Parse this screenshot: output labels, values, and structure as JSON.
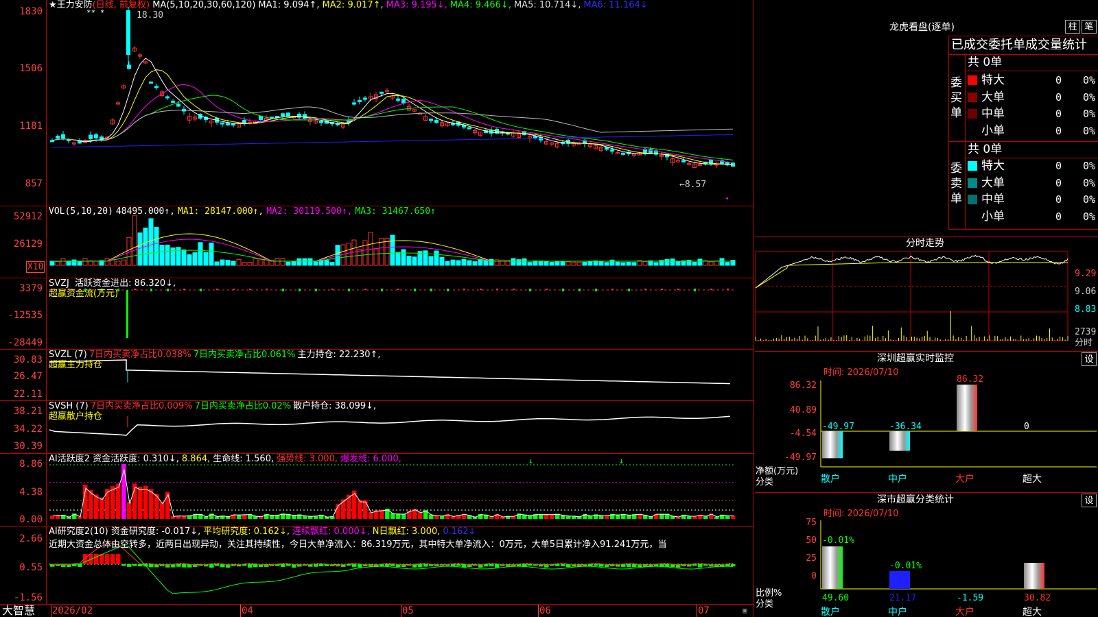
{
  "stock": {
    "name": "王力安防",
    "period": "(日线, 前复权)"
  },
  "main": {
    "y_ticks": [
      "1830",
      "1506",
      "1181",
      "857"
    ],
    "high_label": "18.30",
    "low_label": "8.57",
    "ma_parts": [
      {
        "text": "MA(5,10,20,30,60,120)",
        "color": "#ffffff"
      },
      {
        "text": "MA1: 9.094↑,",
        "color": "#ffffff"
      },
      {
        "text": "MA2: 9.017↑,",
        "color": "#ffff00"
      },
      {
        "text": "MA3: 9.195↓,",
        "color": "#ff00ff"
      },
      {
        "text": "MA4: 9.466↓,",
        "color": "#00ff00"
      },
      {
        "text": "MA5: 10.714↓,",
        "color": "#dddddd"
      },
      {
        "text": "MA6: 11.164↓",
        "color": "#3030ff"
      }
    ]
  },
  "vol": {
    "y_ticks": [
      "52912",
      "26129"
    ],
    "unit": "X10",
    "parts": [
      {
        "text": "VOL(5,10,20)",
        "color": "#ffffff"
      },
      {
        "text": "48495.000↑,",
        "color": "#ffffff"
      },
      {
        "text": "MA1: 28147.000↑,",
        "color": "#ffff00"
      },
      {
        "text": "MA2: 30119.500↑,",
        "color": "#ff00ff"
      },
      {
        "text": "MA3: 31467.650↑",
        "color": "#00ff00"
      }
    ]
  },
  "svzj": {
    "y_ticks": [
      "3379",
      "-12535",
      "-28449"
    ],
    "title": "SVZJ",
    "line1": "活跃资金进出: 86.320↓,",
    "line2": "超赢资金流(万元)"
  },
  "svzl": {
    "y_ticks": [
      "30.83",
      "26.47",
      "22.11"
    ],
    "parts": [
      {
        "text": "SVZL (7)",
        "color": "#ffffff"
      },
      {
        "text": "7日内买卖净占比0.038%",
        "color": "#ff3030"
      },
      {
        "text": "7日内买卖净占比0.061%",
        "color": "#00ff00"
      },
      {
        "text": "主力持仓: 22.230↑,",
        "color": "#ffffff"
      }
    ],
    "line2": "超赢主力持仓"
  },
  "svsh": {
    "y_ticks": [
      "38.21",
      "34.22",
      "30.39"
    ],
    "parts": [
      {
        "text": "SVSH (7)",
        "color": "#ffffff"
      },
      {
        "text": "7日内买卖净占比0.009%",
        "color": "#ff3030"
      },
      {
        "text": "7日内买卖净占比0.02%",
        "color": "#00ff00"
      },
      {
        "text": "散户持仓: 38.099↓,",
        "color": "#ffffff"
      }
    ],
    "line2": "超赢散户持仓"
  },
  "ai1": {
    "y_ticks": [
      "8.86",
      "4.38",
      "0.00"
    ],
    "parts": [
      {
        "text": "AI活跃度2 资金活跃度: 0.310↓,",
        "color": "#ffffff"
      },
      {
        "text": "8.864,",
        "color": "#ffff00"
      },
      {
        "text": "生命线: 1.560,",
        "color": "#ffffff"
      },
      {
        "text": "强势线: 3.000,",
        "color": "#ff3030"
      },
      {
        "text": "爆发线: 6.000,",
        "color": "#ff00ff"
      }
    ]
  },
  "ai2": {
    "y_ticks": [
      "2.66",
      "0.55",
      "-1.56"
    ],
    "parts": [
      {
        "text": "AI研究度2(10) 资金研究度: -0.017↓,",
        "color": "#ffffff"
      },
      {
        "text": "平均研究度: 0.162↓,",
        "color": "#ffff00"
      },
      {
        "text": "连续飘红: 0.000↓,",
        "color": "#ff00ff"
      },
      {
        "text": "N日飘红: 3.000,",
        "color": "#ffff00"
      },
      {
        "text": "0.162↓",
        "color": "#3030ff"
      }
    ],
    "comment": "近期大资金总体由空转多，近两日出现异动，关注其持续性，今日大单净流入：86.319万元，其中特大单净流入：0万元，大单5日累计净入91.241万元，当"
  },
  "xaxis": {
    "brand": "大智慧",
    "labels": [
      "2026/02",
      "04",
      "05",
      "06",
      "07"
    ]
  },
  "lhb": {
    "title": "龙虎看盘(逐单)",
    "btn1": "柱",
    "btn2": "笔",
    "subtitle": "已成交委托单成交量统计",
    "buy": {
      "side": "委买单",
      "total": "共 0单",
      "rows": [
        {
          "label": "特大",
          "count": "0",
          "pct": "0%",
          "color": "#ff0000"
        },
        {
          "label": "大单",
          "count": "0",
          "pct": "0%",
          "color": "#8b0000"
        },
        {
          "label": "中单",
          "count": "0",
          "pct": "0%",
          "color": "#6b0000"
        },
        {
          "label": "小单",
          "count": "0",
          "pct": "0%",
          "color": ""
        }
      ]
    },
    "sell": {
      "side": "委卖单",
      "total": "共 0单",
      "rows": [
        {
          "label": "特大",
          "count": "0",
          "pct": "0%",
          "color": "#00ffff"
        },
        {
          "label": "大单",
          "count": "0",
          "pct": "0%",
          "color": "#008b8b"
        },
        {
          "label": "中单",
          "count": "0",
          "pct": "0%",
          "color": "#007070"
        },
        {
          "label": "小单",
          "count": "0",
          "pct": "0%",
          "color": ""
        }
      ]
    }
  },
  "intraday": {
    "title": "分时走势",
    "prices": [
      "9.29",
      "9.06",
      "8.83"
    ],
    "vol_label": "2739",
    "vol_unit": "分时"
  },
  "monitor": {
    "title": "深圳超赢实时监控",
    "btn": "设",
    "time": "时间: 2026/07/10",
    "y_ticks": [
      "86.32",
      "40.89",
      "-4.54",
      "-49.97"
    ],
    "ylabel": "净额(万元)",
    "xlabel": "分类",
    "values": [
      "-49.97",
      "-36.34",
      "86.32",
      "0"
    ],
    "categories": [
      "散户",
      "中户",
      "大户",
      "超大"
    ]
  },
  "classify": {
    "title": "深市超赢分类统计",
    "btn": "设",
    "time": "时间: 2026/07/10",
    "y_ticks": [
      "75",
      "50",
      "25",
      "0"
    ],
    "ylabel": "比例%",
    "xlabel": "分类",
    "top_labels": [
      "-0.01%",
      "-0.01%"
    ],
    "values": [
      "49.60",
      "21.17",
      "-1.59",
      "30.82"
    ],
    "categories": [
      "散户",
      "中户",
      "大户",
      "超大"
    ]
  }
}
